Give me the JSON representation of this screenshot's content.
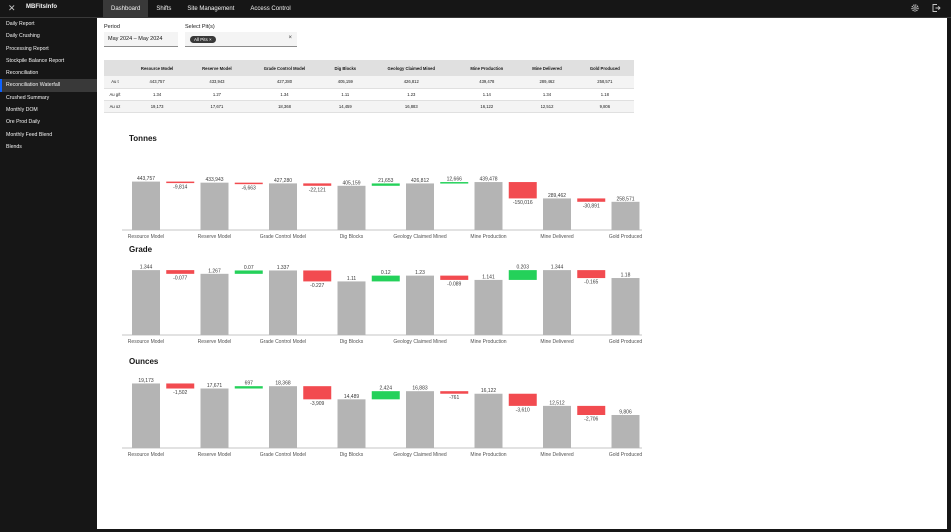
{
  "app": {
    "title": "MBFitsInfo"
  },
  "nav": {
    "tabs": [
      "Dashboard",
      "Shifts",
      "Site Management",
      "Access Control"
    ],
    "active": 0
  },
  "sidebar": {
    "items": [
      "Daily Report",
      "Daily Crushing",
      "Processing Report",
      "Stockpile Balance Report",
      "Reconciliation",
      "Reconciliation Waterfall",
      "Crushed Summary",
      "Monthly DOM",
      "Ore Prod Daily",
      "Monthly Feed Blend",
      "Blends"
    ],
    "active": 5
  },
  "filters": {
    "period_label": "Period",
    "period_value": "May 2024 – May 2024",
    "pits_label": "Select Pit(s)",
    "pits_tag": "All Pits",
    "pits_tag_remove": "×",
    "clear": "×"
  },
  "summary_table": {
    "headers": [
      "",
      "Resource Model",
      "Reserve Model",
      "Grade Control Model",
      "Dig Blocks",
      "Geology Claimed Mined",
      "Mine Production",
      "Mine Delivered",
      "Gold Produced"
    ],
    "rows": [
      [
        "Au t",
        "443,757",
        "433,943",
        "427,280",
        "405,159",
        "426,812",
        "439,478",
        "289,462",
        "258,571"
      ],
      [
        "Au g/t",
        "1.34",
        "1.27",
        "1.34",
        "1.11",
        "1.23",
        "1.14",
        "1.34",
        "1.18"
      ],
      [
        "Au oz",
        "19,173",
        "17,671",
        "18,368",
        "14,459",
        "16,883",
        "16,122",
        "12,512",
        "9,806"
      ]
    ]
  },
  "colors": {
    "total": "#b4b4b4",
    "increase": "#24d15a",
    "decrease": "#f24b50",
    "axis": "#8d8d8d"
  },
  "chart_data": [
    {
      "type": "bar",
      "title": "Tonnes",
      "categories": [
        "Resource Model",
        "Reserve Model",
        "Grade Control Model",
        "Dig Blocks",
        "Geology Claimed Mined",
        "Mine Production",
        "Mine Delivered",
        "Gold Produced"
      ],
      "totals": [
        443757,
        433943,
        427280,
        405159,
        426812,
        439478,
        289462,
        258571
      ],
      "total_labels": [
        "443,757",
        "433,943",
        "427,280",
        "405,159",
        "426,812",
        "439,478",
        "289,462",
        "258,571"
      ],
      "deltas": [
        -9814,
        -6663,
        -22121,
        21653,
        12666,
        -150016,
        -30891
      ],
      "delta_labels": [
        "-9,814",
        "-6,663",
        "-22,121",
        "21,653",
        "12,666",
        "-150,016",
        "-30,891"
      ],
      "ylim": [
        0,
        550000
      ]
    },
    {
      "type": "bar",
      "title": "Grade",
      "categories": [
        "Resource Model",
        "Reserve Model",
        "Grade Control Model",
        "Dig Blocks",
        "Geology Claimed Mined",
        "Mine Production",
        "Mine Delivered",
        "Gold Produced"
      ],
      "totals": [
        1.344,
        1.267,
        1.337,
        1.11,
        1.23,
        1.141,
        1.344,
        1.18
      ],
      "total_labels": [
        "1.344",
        "1.267",
        "1.337",
        "1.11",
        "1.23",
        "1.141",
        "1.344",
        "1.18"
      ],
      "deltas": [
        -0.077,
        0.07,
        -0.227,
        0.12,
        -0.089,
        0.203,
        -0.165
      ],
      "delta_labels": [
        "-0.077",
        "0.07",
        "-0.227",
        "0.12",
        "-0.089",
        "0.203",
        "-0.165"
      ],
      "ylim": [
        0,
        1.45
      ]
    },
    {
      "type": "bar",
      "title": "Ounces",
      "categories": [
        "Resource Model",
        "Reserve Model",
        "Grade Control Model",
        "Dig Blocks",
        "Geology Claimed Mined",
        "Mine Production",
        "Mine Delivered",
        "Gold Produced"
      ],
      "totals": [
        19173,
        17671,
        18368,
        14459,
        16883,
        16122,
        12512,
        9806
      ],
      "total_labels": [
        "19,173",
        "17,671",
        "18,368",
        "14,489",
        "16,883",
        "16,122",
        "12,512",
        "9,806"
      ],
      "deltas": [
        -1502,
        697,
        -3909,
        2424,
        -761,
        -3610,
        -2706
      ],
      "delta_labels": [
        "-1,502",
        "697",
        "-3,909",
        "2,424",
        "-761",
        "-3,610",
        "-2,706"
      ],
      "ylim": [
        0,
        20500
      ]
    }
  ]
}
